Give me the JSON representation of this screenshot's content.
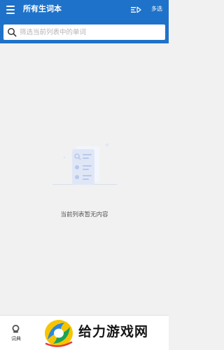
{
  "header": {
    "title": "所有生词本",
    "menu_icon": "menu-icon",
    "queue_icon": "play-queue-icon",
    "multi_select_label": "多选"
  },
  "search": {
    "placeholder": "筛选当前列表中的单词",
    "value": "",
    "icon": "search-icon"
  },
  "empty_state": {
    "message": "当前列表暂无内容",
    "icon": "empty-list-illustration"
  },
  "bottom_nav": {
    "items": [
      {
        "label": "词典",
        "icon": "dictionary-icon"
      }
    ]
  },
  "watermark": {
    "text": "给力游戏网",
    "icon": "site-logo"
  },
  "colors": {
    "primary": "#1f72c9",
    "background": "#f1f1f1",
    "illustration": "#dfe7f7"
  }
}
